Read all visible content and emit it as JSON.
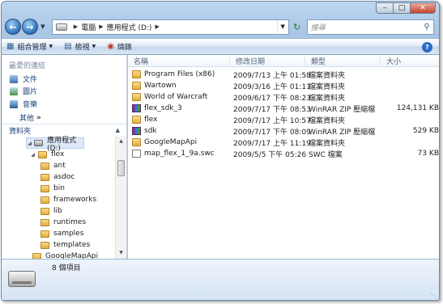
{
  "address": {
    "breadcrumbs": [
      "電腦",
      "應用程式 (D:)"
    ],
    "search_placeholder": "搜尋"
  },
  "commands": {
    "organize": "組合管理",
    "views": "檢視",
    "burn": "燒錄",
    "help": "?"
  },
  "favorites": {
    "title": "最愛的連結",
    "items": [
      "文件",
      "圖片",
      "音樂"
    ],
    "more": "其他",
    "more_chevron": "»"
  },
  "folders": {
    "title": "資料夾",
    "tree": [
      {
        "label": "應用程式 (D:)",
        "kind": "drive",
        "expanded": true,
        "selected": true
      },
      {
        "label": "flex",
        "kind": "folder",
        "expanded": true
      },
      {
        "label": "ant",
        "kind": "folder"
      },
      {
        "label": "asdoc",
        "kind": "folder"
      },
      {
        "label": "bin",
        "kind": "folder"
      },
      {
        "label": "frameworks",
        "kind": "folder"
      },
      {
        "label": "lib",
        "kind": "folder"
      },
      {
        "label": "runtimes",
        "kind": "folder"
      },
      {
        "label": "samples",
        "kind": "folder"
      },
      {
        "label": "templates",
        "kind": "folder"
      },
      {
        "label": "GoogleMapApi",
        "kind": "folder"
      }
    ]
  },
  "file_list": {
    "columns": [
      "名稱",
      "修改日期",
      "類型",
      "大小"
    ],
    "rows": [
      {
        "name": "Program Files (x86)",
        "date": "2009/7/13 上午 01:58",
        "type": "檔案資料夾",
        "size": "",
        "icon": "folder"
      },
      {
        "name": "Wartown",
        "date": "2009/3/16 上午 01:11",
        "type": "檔案資料夾",
        "size": "",
        "icon": "folder"
      },
      {
        "name": "World of Warcraft",
        "date": "2009/6/17 下午 08:23",
        "type": "檔案資料夾",
        "size": "",
        "icon": "folder"
      },
      {
        "name": "flex_sdk_3",
        "date": "2009/7/17 下午 08:53",
        "type": "WinRAR ZIP 壓縮檔",
        "size": "124,131 KB",
        "icon": "rar"
      },
      {
        "name": "flex",
        "date": "2009/7/17 上午 10:57",
        "type": "檔案資料夾",
        "size": "",
        "icon": "folder"
      },
      {
        "name": "sdk",
        "date": "2009/7/17 下午 08:09",
        "type": "WinRAR ZIP 壓縮檔",
        "size": "529 KB",
        "icon": "rar"
      },
      {
        "name": "GoogleMapApi",
        "date": "2009/7/17 上午 11:19",
        "type": "檔案資料夾",
        "size": "",
        "icon": "folder"
      },
      {
        "name": "map_flex_1_9a.swc",
        "date": "2009/5/5 下午 05:26",
        "type": "SWC 檔案",
        "size": "73 KB",
        "icon": "swc"
      }
    ]
  },
  "status": {
    "item_count": "8 個項目"
  }
}
